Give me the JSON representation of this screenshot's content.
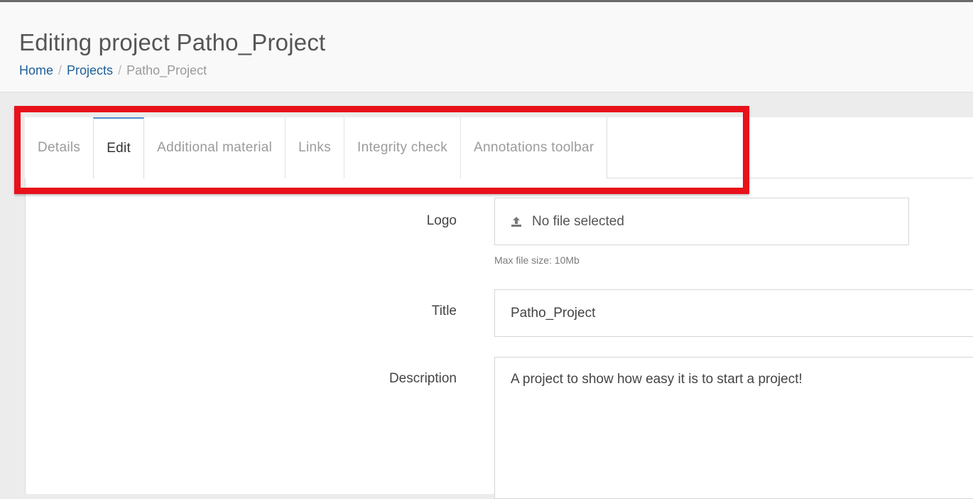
{
  "header": {
    "title": "Editing project Patho_Project",
    "breadcrumb": {
      "home": "Home",
      "separator": "/",
      "projects": "Projects",
      "current": "Patho_Project"
    }
  },
  "tabs": [
    {
      "label": "Details",
      "active": false
    },
    {
      "label": "Edit",
      "active": true
    },
    {
      "label": "Additional material",
      "active": false
    },
    {
      "label": "Links",
      "active": false
    },
    {
      "label": "Integrity check",
      "active": false
    },
    {
      "label": "Annotations toolbar",
      "active": false
    }
  ],
  "form": {
    "logo": {
      "label": "Logo",
      "value": "No file selected",
      "help": "Max file size: 10Mb",
      "icon": "upload-icon"
    },
    "title": {
      "label": "Title",
      "value": "Patho_Project"
    },
    "description": {
      "label": "Description",
      "value": "A project to show how easy it is to start a project!"
    }
  },
  "colors": {
    "link": "#1f5f99",
    "active_tab_accent": "#4a8fcf",
    "highlight": "#e8111a"
  }
}
